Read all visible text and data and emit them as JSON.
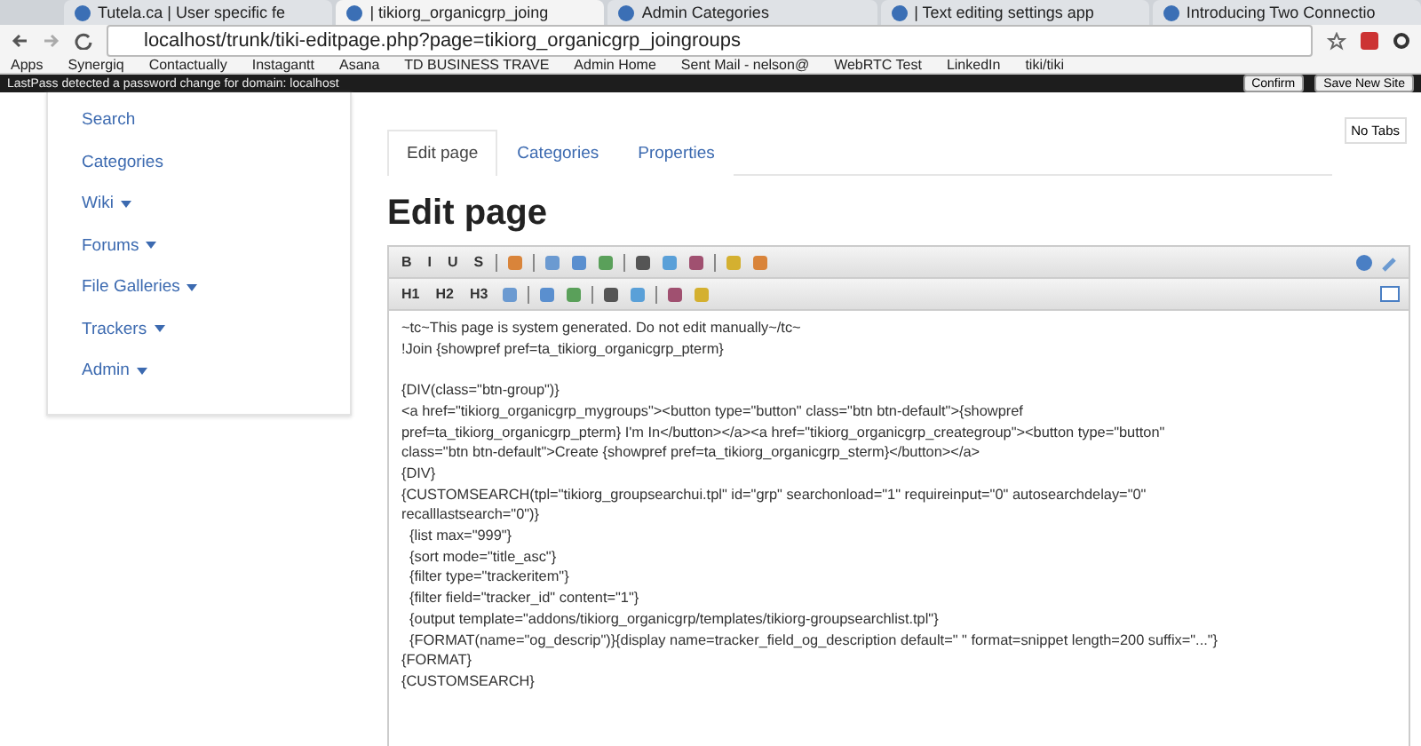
{
  "browser": {
    "tabs": [
      {
        "title": "Tutela.ca | User specific fe",
        "selected": false
      },
      {
        "title": "| tikiorg_organicgrp_joing",
        "selected": true
      },
      {
        "title": "Admin Categories",
        "selected": false
      },
      {
        "title": "| Text editing settings app",
        "selected": false
      },
      {
        "title": "Introducing Two Connectio",
        "selected": false
      }
    ],
    "address": "localhost/trunk/tiki-editpage.php?page=tikiorg_organicgrp_joingroups",
    "bookmarks": [
      "Apps",
      "Synergiq",
      "Contactually",
      "Instagantt",
      "Asana",
      "TD BUSINESS TRAVE",
      "Admin Home",
      "Sent Mail - nelson@",
      "WebRTC Test",
      "LinkedIn",
      "tiki/tiki"
    ],
    "notice": {
      "text": "LastPass detected a password change for domain: localhost",
      "buttons": [
        "Confirm",
        "Save New Site"
      ]
    }
  },
  "sidebar": {
    "items": [
      {
        "label": "Search",
        "expandable": false
      },
      {
        "label": "Categories",
        "expandable": false
      },
      {
        "label": "Wiki",
        "expandable": true
      },
      {
        "label": "Forums",
        "expandable": true
      },
      {
        "label": "File Galleries",
        "expandable": true
      },
      {
        "label": "Trackers",
        "expandable": true
      },
      {
        "label": "Admin",
        "expandable": true
      }
    ]
  },
  "page_tabs": [
    {
      "label": "Edit page",
      "selected": true
    },
    {
      "label": "Categories",
      "selected": false
    },
    {
      "label": "Properties",
      "selected": false
    }
  ],
  "no_tabs_button": "No Tabs",
  "heading": "Edit page",
  "toolbar_rows": [
    [
      {
        "kind": "text",
        "label": "B"
      },
      {
        "kind": "text",
        "label": "I"
      },
      {
        "kind": "text",
        "label": "U"
      },
      {
        "kind": "text",
        "label": "S"
      },
      {
        "kind": "sep"
      },
      {
        "kind": "icon"
      },
      {
        "kind": "sep"
      },
      {
        "kind": "icon"
      },
      {
        "kind": "icon"
      },
      {
        "kind": "icon"
      },
      {
        "kind": "sep"
      },
      {
        "kind": "icon"
      },
      {
        "kind": "icon"
      },
      {
        "kind": "icon"
      },
      {
        "kind": "sep"
      },
      {
        "kind": "icon"
      },
      {
        "kind": "icon"
      }
    ],
    [
      {
        "kind": "text",
        "label": "H1"
      },
      {
        "kind": "text",
        "label": "H2"
      },
      {
        "kind": "text",
        "label": "H3"
      },
      {
        "kind": "icon"
      },
      {
        "kind": "sep"
      },
      {
        "kind": "icon"
      },
      {
        "kind": "icon"
      },
      {
        "kind": "sep"
      },
      {
        "kind": "icon"
      },
      {
        "kind": "icon"
      },
      {
        "kind": "sep"
      },
      {
        "kind": "icon"
      },
      {
        "kind": "icon"
      }
    ]
  ],
  "editor_blocks": [
    [
      "~tc~This page is system generated. Do not edit manually~/tc~",
      "!Join {showpref pref=ta_tikiorg_organicgrp_pterm}"
    ],
    [
      "{DIV(class=\"btn-group\")}",
      "<a href=\"tikiorg_organicgrp_mygroups\"><button type=\"button\" class=\"btn btn-default\">{showpref",
      "pref=ta_tikiorg_organicgrp_pterm} I'm In</button></a><a href=\"tikiorg_organicgrp_creategroup\"><button type=\"button\"",
      "class=\"btn btn-default\">Create {showpref pref=ta_tikiorg_organicgrp_sterm}</button></a>",
      "{DIV}",
      "{CUSTOMSEARCH(tpl=\"tikiorg_groupsearchui.tpl\" id=\"grp\" searchonload=\"1\" requireinput=\"0\" autosearchdelay=\"0\"",
      "recalllastsearch=\"0\")}",
      "  {list max=\"999\"}",
      "  {sort mode=\"title_asc\"}",
      "  {filter type=\"trackeritem\"}",
      "  {filter field=\"tracker_id\" content=\"1\"}",
      "  {output template=\"addons/tikiorg_organicgrp/templates/tikiorg-groupsearchlist.tpl\"}",
      "  {FORMAT(name=\"og_descrip\")}{display name=tracker_field_og_description default=\" \" format=snippet length=200 suffix=\"...\"}",
      "{FORMAT}",
      "{CUSTOMSEARCH}"
    ]
  ]
}
